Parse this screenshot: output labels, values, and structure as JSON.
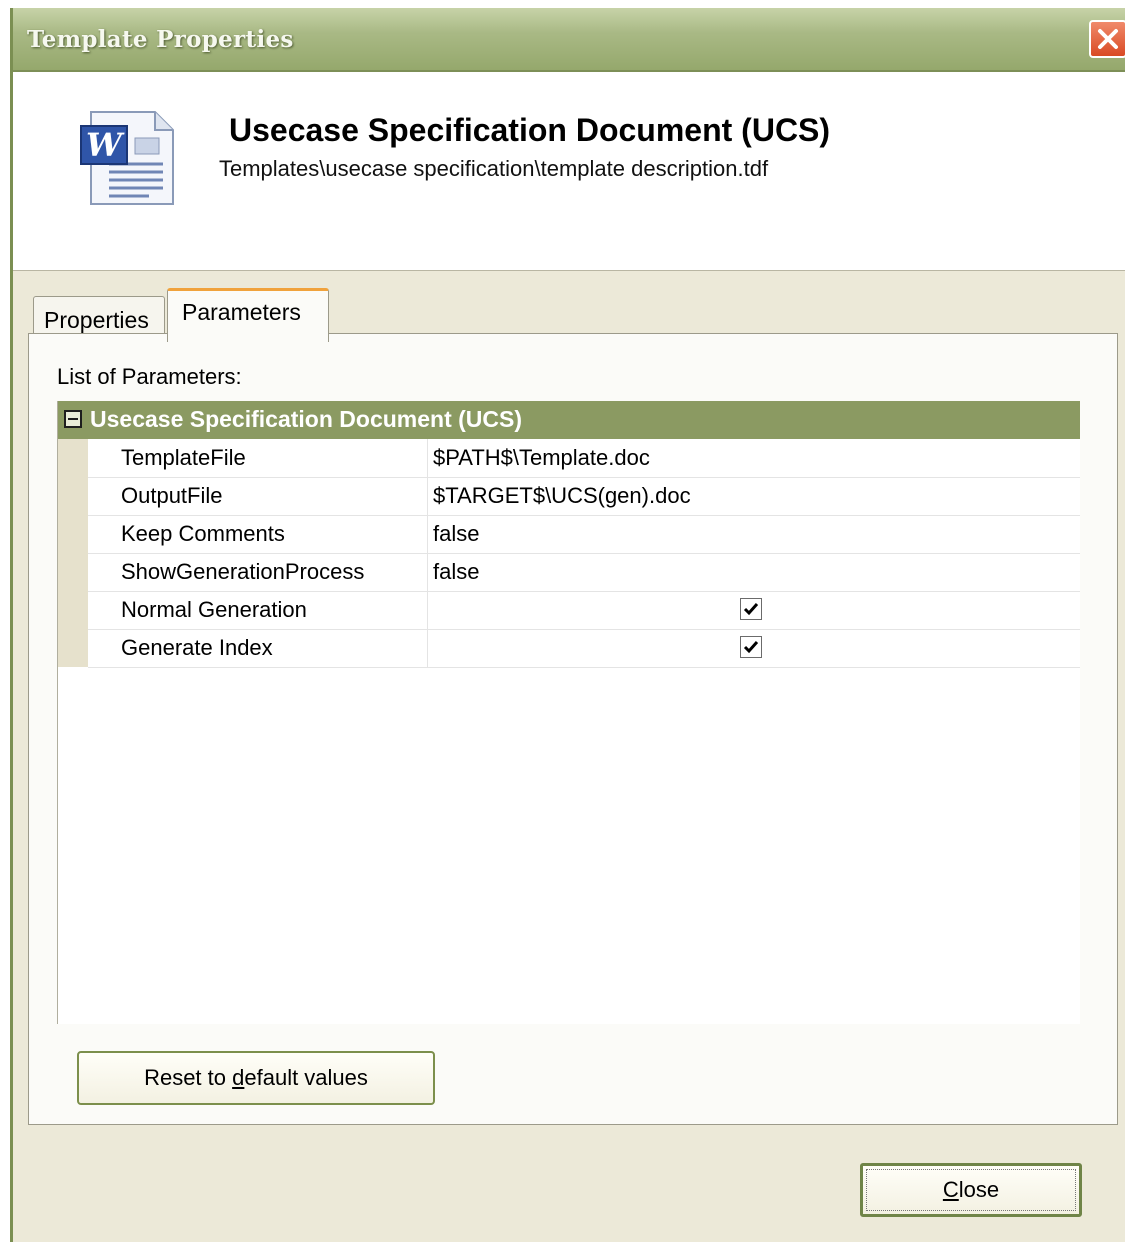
{
  "window": {
    "title": "Template Properties",
    "close_icon": "close-icon"
  },
  "header": {
    "icon": "word-document-icon",
    "title": "Usecase Specification Document (UCS)",
    "path": "Templates\\usecase specification\\template description.tdf"
  },
  "tabs": [
    {
      "label": "Properties",
      "selected": false
    },
    {
      "label": "Parameters",
      "selected": true
    }
  ],
  "parameters": {
    "list_label": "List of Parameters:",
    "category": {
      "label": "Usecase Specification Document (UCS)",
      "expanded": true,
      "toggle_icon": "collapse-minus-icon"
    },
    "rows": [
      {
        "name": "TemplateFile",
        "value": "$PATH$\\Template.doc"
      },
      {
        "name": "OutputFile",
        "value": "$TARGET$\\UCS(gen).doc"
      },
      {
        "name": "Keep Comments",
        "value": "false"
      },
      {
        "name": "ShowGenerationProcess",
        "value": "false"
      },
      {
        "name": "Normal Generation",
        "checked": true
      },
      {
        "name": "Generate Index",
        "checked": true
      }
    ]
  },
  "buttons": {
    "reset": {
      "before": "Reset to ",
      "mnemonic": "d",
      "after": "efault values"
    },
    "close": {
      "before": "",
      "mnemonic": "C",
      "after": "lose"
    }
  },
  "colors": {
    "titlebar": "#a9b985",
    "category_header": "#8b9a62",
    "active_tab_accent": "#f0a23c",
    "dialog_background": "#ece9d8"
  }
}
